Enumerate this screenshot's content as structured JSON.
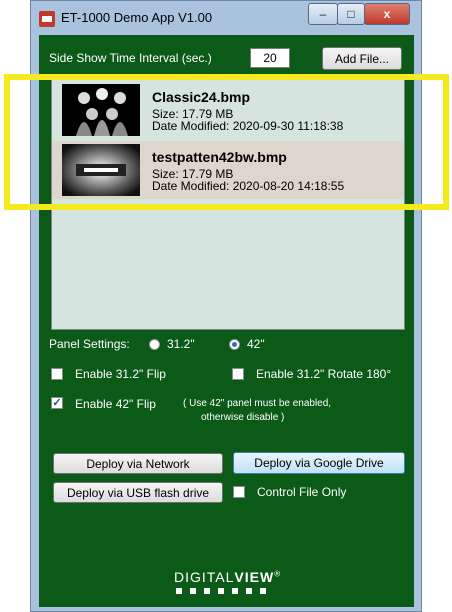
{
  "window": {
    "title": "ET-1000 Demo App V1.00",
    "close_glyph": "x",
    "minimize_glyph": "–",
    "maximize_glyph": "□"
  },
  "controls": {
    "interval_label": "Side Show Time Interval (sec.)",
    "interval_value": "20",
    "add_file_label": "Add File..."
  },
  "files": [
    {
      "name": "Classic24.bmp",
      "size": "Size: 17.79 MB",
      "modified": "Date Modified: 2020-09-30 11:18:38",
      "thumb_icon": "group-photo-thumbnail"
    },
    {
      "name": "testpatten42bw.bmp",
      "size": "Size: 17.79 MB",
      "modified": "Date Modified: 2020-08-20 14:18:55",
      "thumb_icon": "test-pattern-thumbnail"
    }
  ],
  "panel": {
    "label": "Panel Settings:",
    "options": [
      "31.2\"",
      "42\""
    ],
    "selected": "42\"",
    "flip_31_label": "Enable 31.2\" Flip",
    "rotate_31_label": "Enable 31.2\" Rotate 180°",
    "flip_42_label": "Enable 42\" Flip",
    "flip_42_checked": true,
    "flip_42_note_line1": "( Use 42\" panel must be enabled,",
    "flip_42_note_line2": "otherwise disable )"
  },
  "deploy": {
    "network_label": "Deploy via Network",
    "google_drive_label": "Deploy via Google Drive",
    "usb_label": "Deploy via USB flash drive",
    "control_file_label": "Control File Only"
  },
  "logo": {
    "text_light": "DIGITAL",
    "text_bold": "VIEW",
    "mark": "®"
  },
  "colors": {
    "panel_bg": "#0c5a18",
    "highlight": "#f5ea1e",
    "close_button": "#c0392b"
  }
}
